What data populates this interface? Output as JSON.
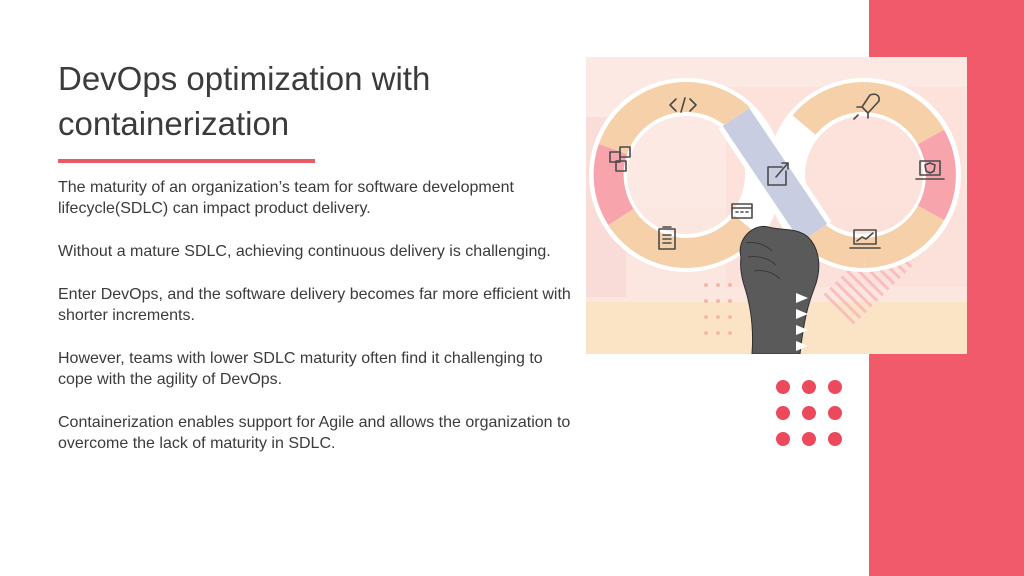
{
  "slide": {
    "title_line1": "DevOps optimization with",
    "title_line2": "containerization",
    "paragraphs": [
      "The maturity of an organization’s team for software development lifecycle(SDLC) can impact product delivery.",
      "Without a mature SDLC, achieving continuous delivery is challenging.",
      "Enter DevOps, and the software delivery becomes far more efficient with shorter increments.",
      "However, teams with lower SDLC maturity often find it challenging to cope with the agility of DevOps.",
      "Containerization enables support for Agile and allows the organization to overcome the lack of maturity in SDLC."
    ]
  },
  "colors": {
    "accent_red": "#f05a6a",
    "dot_red": "#ec4a5c",
    "text": "#3b3b3b",
    "peach": "#f6d9b4",
    "pink": "#f9a0ac",
    "lavender": "#c9cde2"
  },
  "illustration": {
    "subject": "devops-infinity-loop-with-hand",
    "icons": [
      "code-icon",
      "rocket-icon",
      "boxes-icon",
      "share-icon",
      "shield-laptop-icon",
      "calendar-icon",
      "clipboard-icon",
      "chart-laptop-icon"
    ]
  }
}
